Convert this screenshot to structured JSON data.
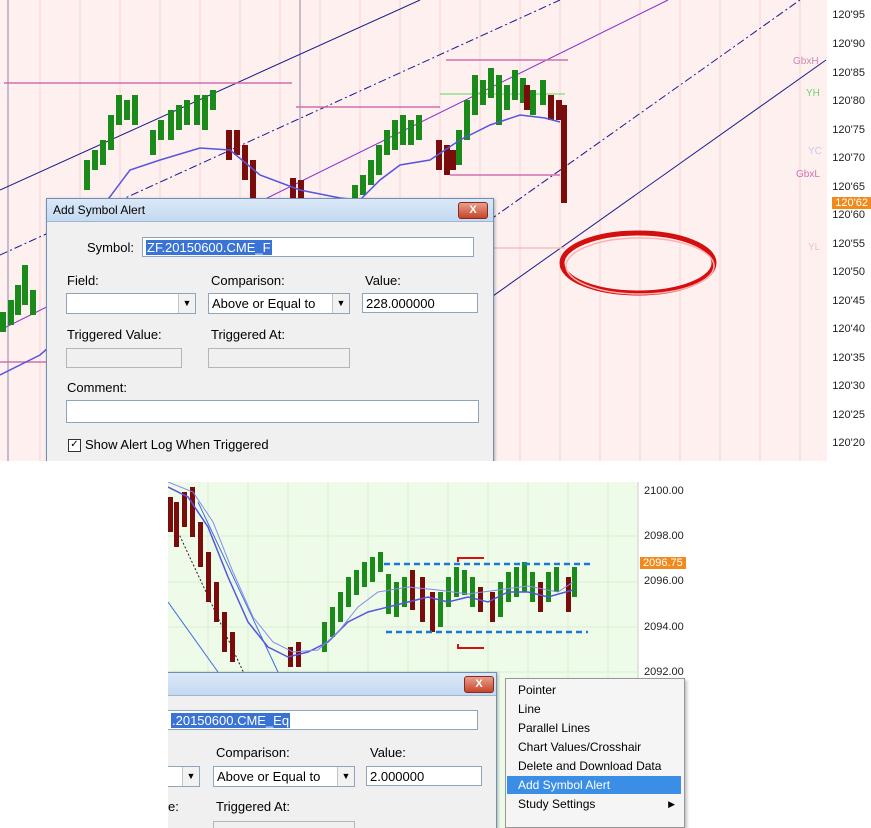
{
  "top": {
    "price_axis": [
      "120'95",
      "120'90",
      "120'85",
      "120'80",
      "120'75",
      "120'70",
      "120'65",
      "120'60",
      "120'55",
      "120'50",
      "120'45",
      "120'40",
      "120'35",
      "120'30",
      "120'25",
      "120'20"
    ],
    "current_price": "120'62",
    "line_tags": {
      "gbxh": "GbxH",
      "yh": "YH",
      "yc": "YC",
      "gbxl": "GbxL",
      "yl": "YL"
    },
    "dialog": {
      "title": "Add Symbol Alert",
      "close": "X",
      "symbol_label": "Symbol:",
      "symbol_value": "ZF.20150600.CME_F",
      "field_label": "Field:",
      "field_value": "",
      "comparison_label": "Comparison:",
      "comparison_value": "Above or Equal to",
      "value_label": "Value:",
      "value_value": "228.000000",
      "triggered_value_label": "Triggered Value:",
      "triggered_at_label": "Triggered At:",
      "comment_label": "Comment:",
      "show_log_label": "Show Alert Log When Triggered",
      "show_log_checked": true
    }
  },
  "bottom": {
    "price_axis": [
      "2100.00",
      "2098.00",
      "2096.00",
      "2094.00",
      "2092.00"
    ],
    "current_price": "2096.75",
    "dialog": {
      "close": "X",
      "symbol_value": ".20150600.CME_Eq",
      "comparison_label": "Comparison:",
      "comparison_value": "Above or Equal to",
      "value_label": "Value:",
      "value_value": "2.000000",
      "triggered_value_label_fragment": "e:",
      "triggered_at_label": "Triggered At:"
    },
    "context_menu": {
      "items": [
        "Pointer",
        "Line",
        "Parallel Lines",
        "Chart Values/Crosshair",
        "Delete and Download Data",
        "Add Symbol Alert",
        "Study Settings"
      ],
      "highlighted_index": 5
    }
  },
  "colors": {
    "up_bar": "#1a8a1a",
    "down_bar": "#7a0c0c",
    "accent_orange": "#f08a1c",
    "menu_highlight": "#3a8ee6"
  }
}
